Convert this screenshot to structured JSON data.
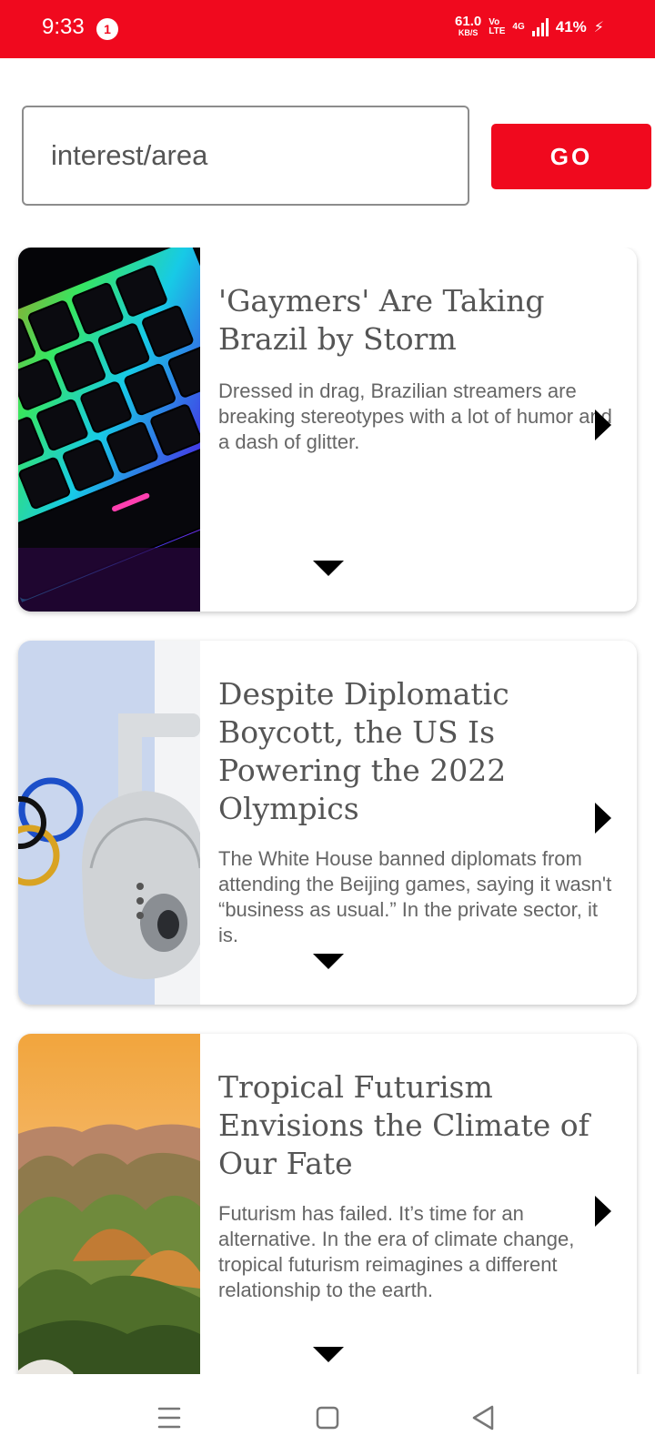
{
  "status_bar": {
    "time": "9:33",
    "notification_count": "1",
    "net_speed": "61.0",
    "net_speed_unit": "KB/S",
    "volte_top": "Vo",
    "volte_bottom": "LTE",
    "network": "4G",
    "battery": "41%",
    "bar_color": "#f0091e"
  },
  "search": {
    "placeholder": "interest/area",
    "value": "",
    "go_label": "GO"
  },
  "articles": [
    {
      "title": "'Gaymers' Are Taking Brazil by Storm",
      "description": "Dressed in drag, Brazilian streamers are breaking stereotypes with a lot of humor and a dash of glitter.",
      "image": "rgb-keyboard-image"
    },
    {
      "title": "Despite Diplomatic Boycott, the US Is Powering the 2022 Olympics",
      "description": "The White House banned diplomats from attending the Beijing games, saying it wasn't “business as usual.” In the private sector, it is.",
      "image": "surveillance-camera-olympics-image"
    },
    {
      "title": "Tropical Futurism Envisions the Climate of Our Fate",
      "description": "Futurism has failed. It’s time for an alternative. In the era of climate change, tropical futurism reimagines a different relationship to the earth.",
      "image": "tropical-hills-landscape-image"
    }
  ],
  "nav": {
    "menu_icon": "menu-icon",
    "home_icon": "home-square-icon",
    "back_icon": "back-triangle-icon"
  }
}
